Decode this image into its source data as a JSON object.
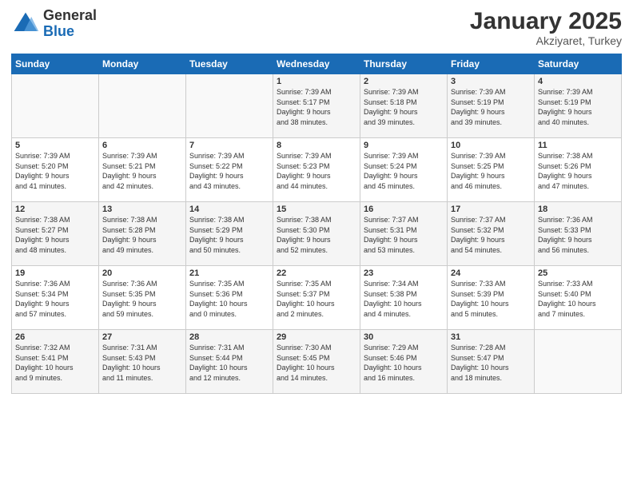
{
  "header": {
    "logo_general": "General",
    "logo_blue": "Blue",
    "month_year": "January 2025",
    "location": "Akziyaret, Turkey"
  },
  "weekdays": [
    "Sunday",
    "Monday",
    "Tuesday",
    "Wednesday",
    "Thursday",
    "Friday",
    "Saturday"
  ],
  "weeks": [
    [
      {
        "day": "",
        "info": ""
      },
      {
        "day": "",
        "info": ""
      },
      {
        "day": "",
        "info": ""
      },
      {
        "day": "1",
        "info": "Sunrise: 7:39 AM\nSunset: 5:17 PM\nDaylight: 9 hours\nand 38 minutes."
      },
      {
        "day": "2",
        "info": "Sunrise: 7:39 AM\nSunset: 5:18 PM\nDaylight: 9 hours\nand 39 minutes."
      },
      {
        "day": "3",
        "info": "Sunrise: 7:39 AM\nSunset: 5:19 PM\nDaylight: 9 hours\nand 39 minutes."
      },
      {
        "day": "4",
        "info": "Sunrise: 7:39 AM\nSunset: 5:19 PM\nDaylight: 9 hours\nand 40 minutes."
      }
    ],
    [
      {
        "day": "5",
        "info": "Sunrise: 7:39 AM\nSunset: 5:20 PM\nDaylight: 9 hours\nand 41 minutes."
      },
      {
        "day": "6",
        "info": "Sunrise: 7:39 AM\nSunset: 5:21 PM\nDaylight: 9 hours\nand 42 minutes."
      },
      {
        "day": "7",
        "info": "Sunrise: 7:39 AM\nSunset: 5:22 PM\nDaylight: 9 hours\nand 43 minutes."
      },
      {
        "day": "8",
        "info": "Sunrise: 7:39 AM\nSunset: 5:23 PM\nDaylight: 9 hours\nand 44 minutes."
      },
      {
        "day": "9",
        "info": "Sunrise: 7:39 AM\nSunset: 5:24 PM\nDaylight: 9 hours\nand 45 minutes."
      },
      {
        "day": "10",
        "info": "Sunrise: 7:39 AM\nSunset: 5:25 PM\nDaylight: 9 hours\nand 46 minutes."
      },
      {
        "day": "11",
        "info": "Sunrise: 7:38 AM\nSunset: 5:26 PM\nDaylight: 9 hours\nand 47 minutes."
      }
    ],
    [
      {
        "day": "12",
        "info": "Sunrise: 7:38 AM\nSunset: 5:27 PM\nDaylight: 9 hours\nand 48 minutes."
      },
      {
        "day": "13",
        "info": "Sunrise: 7:38 AM\nSunset: 5:28 PM\nDaylight: 9 hours\nand 49 minutes."
      },
      {
        "day": "14",
        "info": "Sunrise: 7:38 AM\nSunset: 5:29 PM\nDaylight: 9 hours\nand 50 minutes."
      },
      {
        "day": "15",
        "info": "Sunrise: 7:38 AM\nSunset: 5:30 PM\nDaylight: 9 hours\nand 52 minutes."
      },
      {
        "day": "16",
        "info": "Sunrise: 7:37 AM\nSunset: 5:31 PM\nDaylight: 9 hours\nand 53 minutes."
      },
      {
        "day": "17",
        "info": "Sunrise: 7:37 AM\nSunset: 5:32 PM\nDaylight: 9 hours\nand 54 minutes."
      },
      {
        "day": "18",
        "info": "Sunrise: 7:36 AM\nSunset: 5:33 PM\nDaylight: 9 hours\nand 56 minutes."
      }
    ],
    [
      {
        "day": "19",
        "info": "Sunrise: 7:36 AM\nSunset: 5:34 PM\nDaylight: 9 hours\nand 57 minutes."
      },
      {
        "day": "20",
        "info": "Sunrise: 7:36 AM\nSunset: 5:35 PM\nDaylight: 9 hours\nand 59 minutes."
      },
      {
        "day": "21",
        "info": "Sunrise: 7:35 AM\nSunset: 5:36 PM\nDaylight: 10 hours\nand 0 minutes."
      },
      {
        "day": "22",
        "info": "Sunrise: 7:35 AM\nSunset: 5:37 PM\nDaylight: 10 hours\nand 2 minutes."
      },
      {
        "day": "23",
        "info": "Sunrise: 7:34 AM\nSunset: 5:38 PM\nDaylight: 10 hours\nand 4 minutes."
      },
      {
        "day": "24",
        "info": "Sunrise: 7:33 AM\nSunset: 5:39 PM\nDaylight: 10 hours\nand 5 minutes."
      },
      {
        "day": "25",
        "info": "Sunrise: 7:33 AM\nSunset: 5:40 PM\nDaylight: 10 hours\nand 7 minutes."
      }
    ],
    [
      {
        "day": "26",
        "info": "Sunrise: 7:32 AM\nSunset: 5:41 PM\nDaylight: 10 hours\nand 9 minutes."
      },
      {
        "day": "27",
        "info": "Sunrise: 7:31 AM\nSunset: 5:43 PM\nDaylight: 10 hours\nand 11 minutes."
      },
      {
        "day": "28",
        "info": "Sunrise: 7:31 AM\nSunset: 5:44 PM\nDaylight: 10 hours\nand 12 minutes."
      },
      {
        "day": "29",
        "info": "Sunrise: 7:30 AM\nSunset: 5:45 PM\nDaylight: 10 hours\nand 14 minutes."
      },
      {
        "day": "30",
        "info": "Sunrise: 7:29 AM\nSunset: 5:46 PM\nDaylight: 10 hours\nand 16 minutes."
      },
      {
        "day": "31",
        "info": "Sunrise: 7:28 AM\nSunset: 5:47 PM\nDaylight: 10 hours\nand 18 minutes."
      },
      {
        "day": "",
        "info": ""
      }
    ]
  ]
}
